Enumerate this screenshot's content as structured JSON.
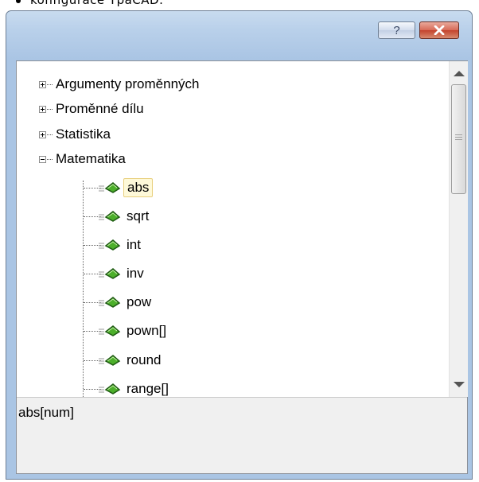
{
  "caption": {
    "text": "konfigurace TpaCAD."
  },
  "window": {
    "help_button_label": "?",
    "close_icon": "close-x-icon"
  },
  "tree": {
    "groups": [
      {
        "label": "Argumenty proměnných",
        "expanded": false
      },
      {
        "label": "Proměnné dílu",
        "expanded": false
      },
      {
        "label": "Statistika",
        "expanded": false
      },
      {
        "label": "Matematika",
        "expanded": true
      }
    ],
    "functions": [
      "abs",
      "sqrt",
      "int",
      "inv",
      "pow",
      "pown[]",
      "round",
      "range[]"
    ],
    "selected": "abs",
    "function_icon": "function-icon"
  },
  "description": {
    "text": "abs[num]"
  },
  "colors": {
    "selection_bg": "#fef9d9",
    "selection_border": "#e8cf7d",
    "close_button": "#c3432c",
    "titlebar": "#b9d0ea"
  }
}
